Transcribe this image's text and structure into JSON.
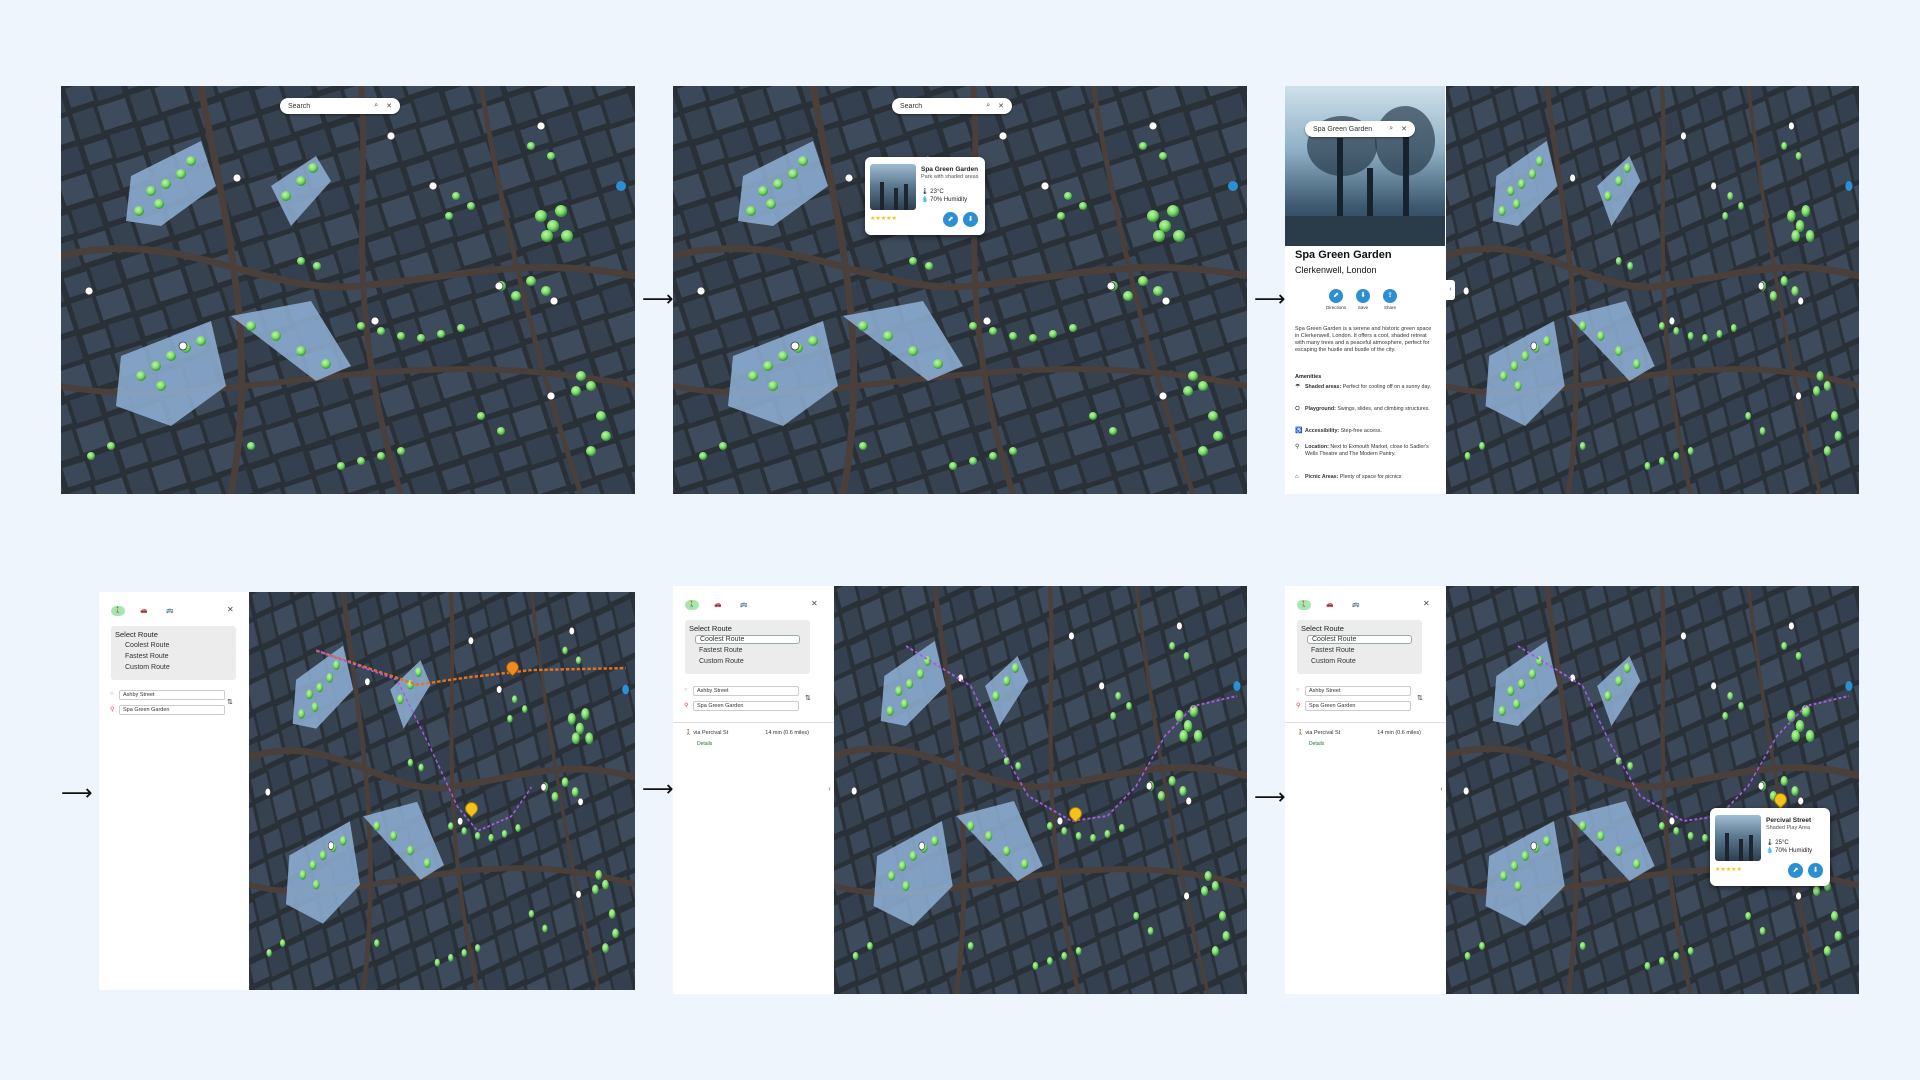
{
  "frames": {
    "f1": {
      "search_placeholder": "Search"
    },
    "f2": {
      "search_placeholder": "Search",
      "popup": {
        "name": "Spa Green Garden",
        "subtitle": "Park with shaded areas",
        "temperature": "23°C",
        "humidity": "70% Humidity",
        "rating_stars": 5
      }
    },
    "f3": {
      "search_value": "Spa Green Garden",
      "title": "Spa Green Garden",
      "location": "Clerkenwell, London",
      "actions": [
        "Directions",
        "Save",
        "Share"
      ],
      "description": "Spa Green Garden is a serene and historic green space in Clerkenwell, London. It offers a cool, shaded retreat with many trees and a peaceful atmosphere, perfect for escaping the hustle and bustle of the city.",
      "amenities_title": "Amenities",
      "amenities": [
        {
          "icon": "umbrella-icon",
          "label": "Shaded areas:",
          "text": "Perfect for cooling off on a sunny day."
        },
        {
          "icon": "swing-icon",
          "label": "Playground:",
          "text": "Swings, slides, and climbing structures."
        },
        {
          "icon": "accessible-icon",
          "label": "Accessibility:",
          "text": "Step-free access."
        },
        {
          "icon": "location-pin-icon",
          "label": "Location:",
          "text": "Next to Exmouth Market, close to Sadler's Wells Theatre and The Modern Pantry."
        },
        {
          "icon": "picnic-icon",
          "label": "Picnic Areas:",
          "text": "Plenty of space for picnics"
        }
      ]
    },
    "f4": {
      "select_route_title": "Select Route",
      "options": [
        "Coolest Route",
        "Fastest Route",
        "Custom Route"
      ],
      "from": "Ashby Street",
      "to": "Spa Green Garden"
    },
    "f5": {
      "select_route_title": "Select Route",
      "options": [
        "Coolest Route",
        "Fastest Route",
        "Custom Route"
      ],
      "active_option": "Coolest Route",
      "from": "Ashby Street",
      "to": "Spa Green Garden",
      "result": {
        "via": "via Percival St",
        "time": "14 min (0.6 miles)",
        "details": "Details"
      }
    },
    "f6": {
      "select_route_title": "Select Route",
      "options": [
        "Coolest Route",
        "Fastest Route",
        "Custom Route"
      ],
      "active_option": "Coolest Route",
      "from": "Ashby Street",
      "to": "Spa Green Garden",
      "result": {
        "via": "via Percival St",
        "time": "14 min (0.6 miles)",
        "details": "Details"
      },
      "popup": {
        "name": "Percival Street",
        "subtitle": "Shaded Play Area",
        "temperature": "25°C",
        "humidity": "70% Humidity",
        "rating_stars": 5
      }
    }
  },
  "icons": {
    "search": "search-icon",
    "clear": "close-icon",
    "arrow": "right-arrow-icon"
  },
  "colors": {
    "background": "#eef5fd",
    "map_base": "#2a3038",
    "building": "#3a4656",
    "park": "#8fb0d6",
    "tree": "#7fdc6b",
    "accent_blue": "#2d8fd3",
    "route_purple": "#a55ce0",
    "route_orange": "#e8731c",
    "pin_yellow": "#f4c21b"
  }
}
